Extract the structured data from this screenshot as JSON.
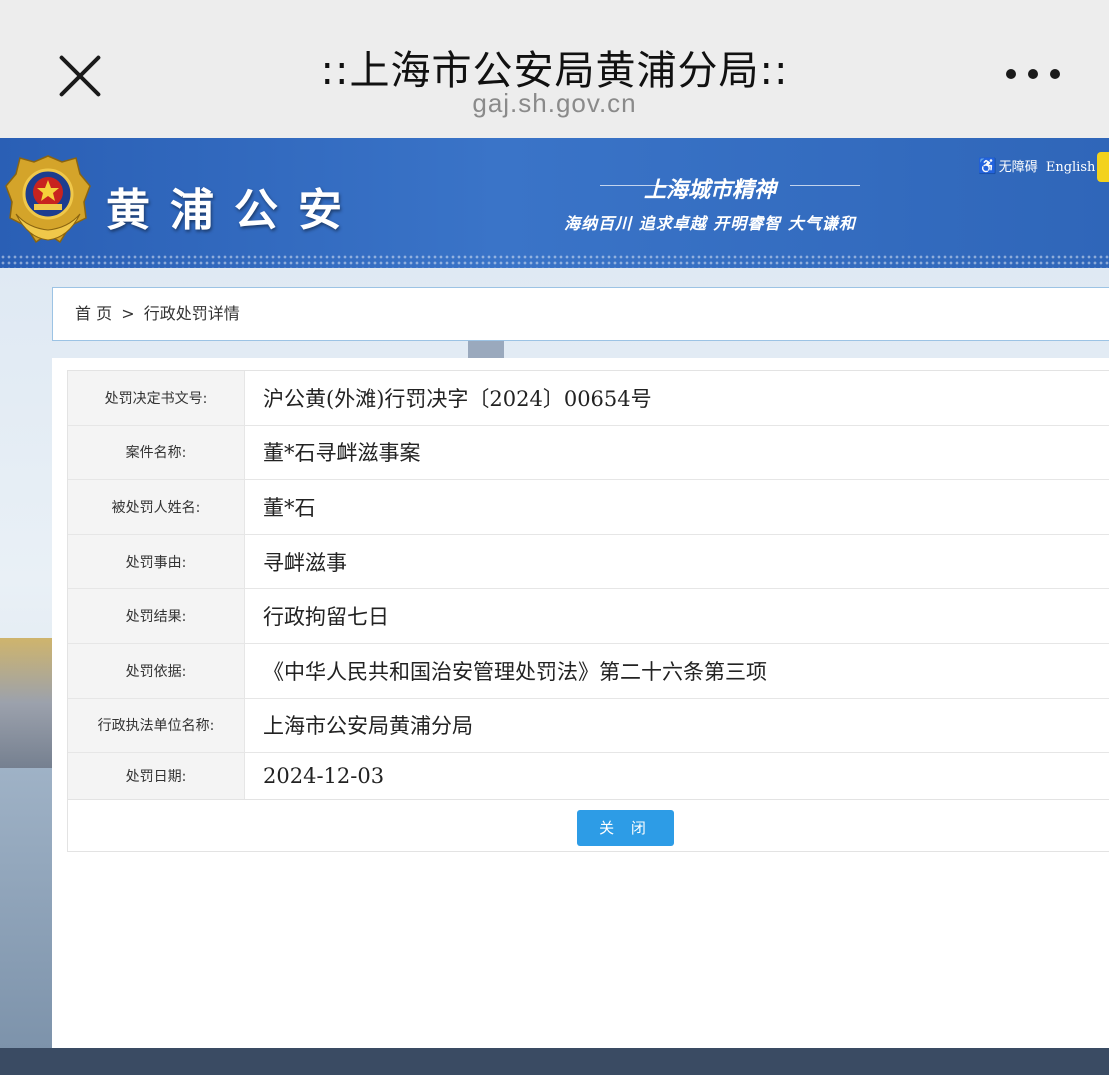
{
  "browser": {
    "title": "::上海市公安局黄浦分局::",
    "url": "gaj.sh.gov.cn"
  },
  "header": {
    "logo_text": "黄浦公安",
    "slogan_title": "上海城市精神",
    "slogan_sub": "海纳百川 追求卓越 开明睿智 大气谦和",
    "accessibility_label": "无障碍",
    "english_label": "English",
    "brand_color": "#2f66b9"
  },
  "breadcrumb": {
    "home": "首 页",
    "separator": ">",
    "current": "行政处罚详情"
  },
  "details": {
    "rows": [
      {
        "label": "处罚决定书文号:",
        "value": "沪公黄(外滩)行罚决字〔2024〕00654号"
      },
      {
        "label": "案件名称:",
        "value": "董*石寻衅滋事案"
      },
      {
        "label": "被处罚人姓名:",
        "value": "董*石"
      },
      {
        "label": "处罚事由:",
        "value": "寻衅滋事"
      },
      {
        "label": "处罚结果:",
        "value": "行政拘留七日"
      },
      {
        "label": "处罚依据:",
        "value": "《中华人民共和国治安管理处罚法》第二十六条第三项"
      },
      {
        "label": "行政执法单位名称:",
        "value": "上海市公安局黄浦分局"
      },
      {
        "label": "处罚日期:",
        "value": "2024-12-03"
      }
    ]
  },
  "actions": {
    "close_label": "关 闭",
    "close_color": "#2d9ce6"
  }
}
